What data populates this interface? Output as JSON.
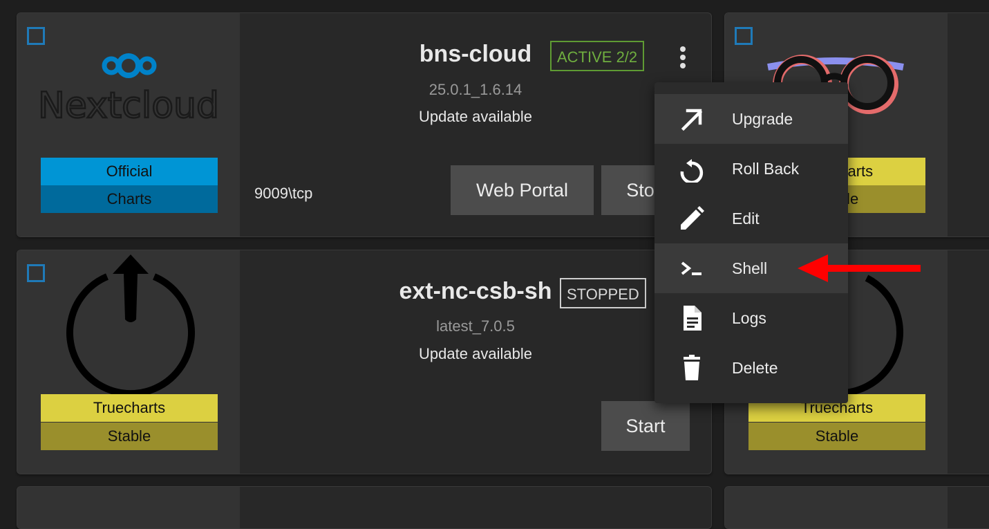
{
  "apps": [
    {
      "name": "bns-cloud",
      "version": "25.0.1_1.6.14",
      "update": "Update available",
      "status": "ACTIVE 2/2",
      "badge_top": "Official",
      "badge_bottom": "Charts",
      "logo_text": "Nextcloud",
      "port": "9009\\tcp",
      "web_portal_label": "Web Portal",
      "stop_label": "Stop"
    },
    {
      "name": "ext-nc-csb-sh",
      "version": "latest_7.0.5",
      "update": "Update available",
      "status": "STOPPED",
      "badge_top": "Truecharts",
      "badge_bottom": "Stable",
      "start_label": "Start"
    }
  ],
  "right_column": [
    {
      "badge_top": "Truecharts",
      "badge_bottom": "Stable"
    },
    {
      "badge_top": "Truecharts",
      "badge_bottom": "Stable"
    }
  ],
  "menu": {
    "items": [
      {
        "label": "Upgrade",
        "icon": "arrow-up-right-icon"
      },
      {
        "label": "Roll Back",
        "icon": "rollback-icon"
      },
      {
        "label": "Edit",
        "icon": "pencil-icon"
      },
      {
        "label": "Shell",
        "icon": "terminal-icon"
      },
      {
        "label": "Logs",
        "icon": "document-icon"
      },
      {
        "label": "Delete",
        "icon": "trash-icon"
      }
    ]
  },
  "colors": {
    "official_top": "#0095d5",
    "official_bottom": "#006a9c",
    "truecharts_top": "#dcd041",
    "truecharts_bottom": "#9a8f2c",
    "active": "#6fae3f",
    "annotation_arrow": "#ff0000"
  }
}
